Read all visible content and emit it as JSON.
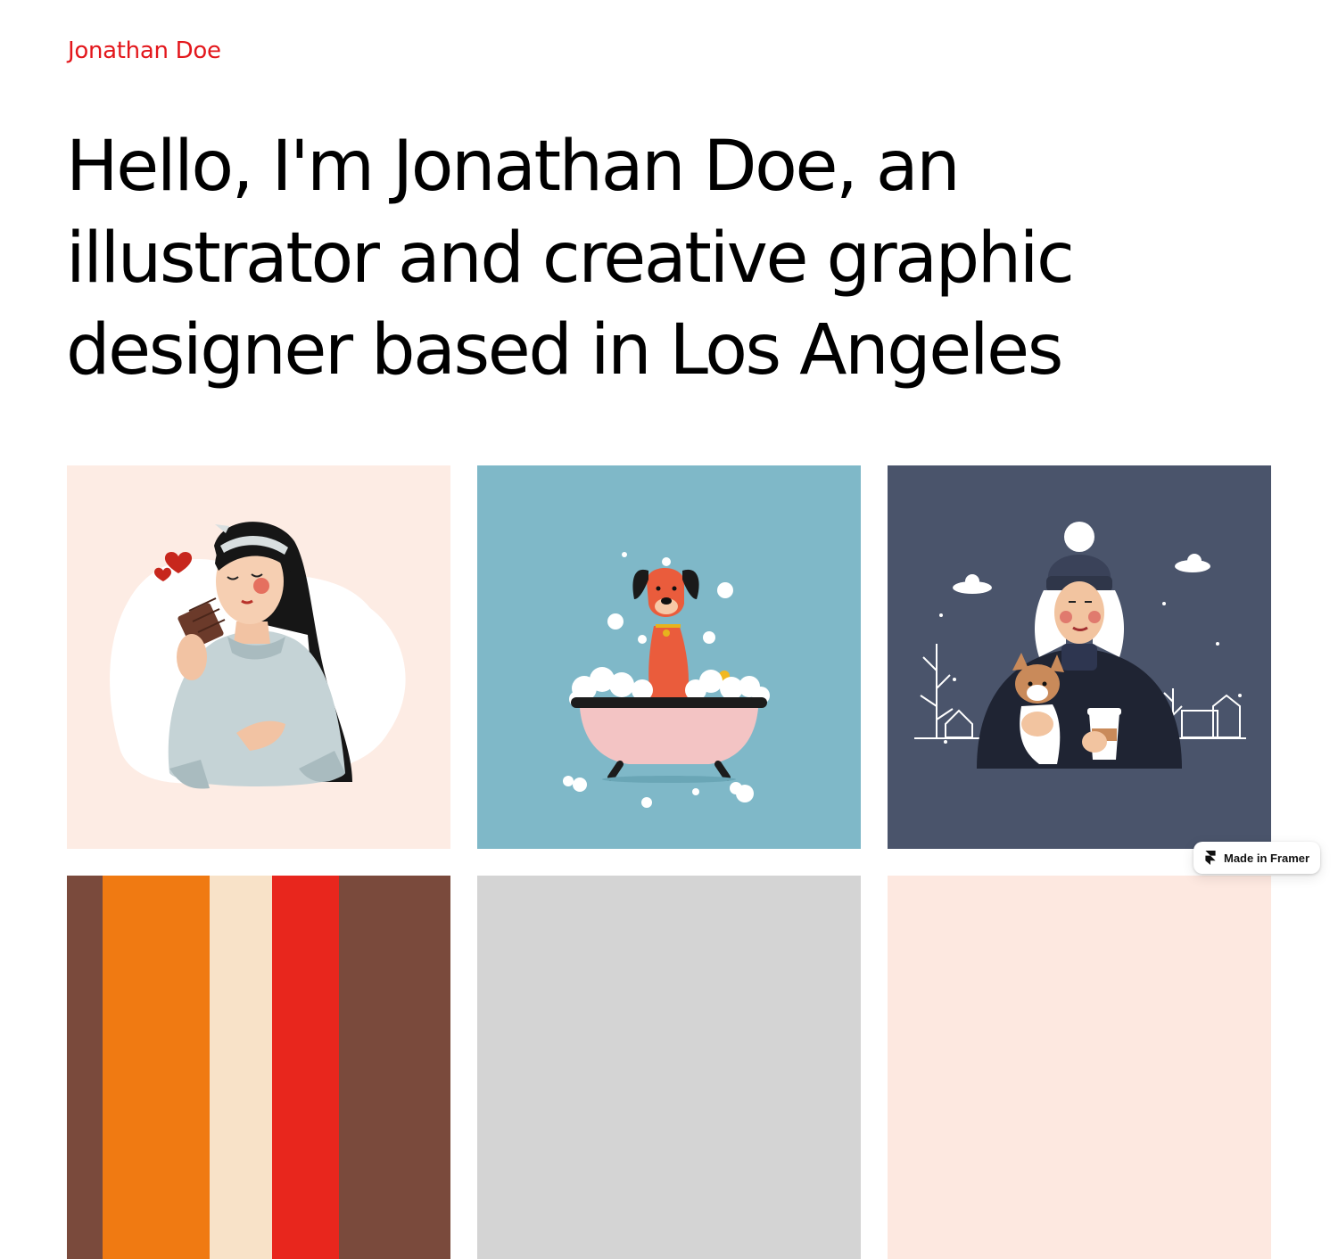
{
  "header": {
    "brand_name": "Jonathan Doe",
    "brand_color": "#e3171c"
  },
  "hero": {
    "lines": [
      "Hello, I'm Jonathan Doe, an",
      "illustrator and creative graphic",
      "designer based in Los Angeles"
    ]
  },
  "gallery": {
    "items": [
      {
        "subject": "woman eating chocolate",
        "background": "#fdece4"
      },
      {
        "subject": "dog in bathtub",
        "background": "#7fb8c8"
      },
      {
        "subject": "woman with dog and coffee in snow",
        "background": "#4a546b"
      },
      {
        "subject": "abstract colorful illustration",
        "background": "#f07a12"
      },
      {
        "subject": "grey illustration",
        "background": "#d4d4d4"
      },
      {
        "subject": "peach illustration",
        "background": "#fde8e0"
      }
    ]
  },
  "framer_badge": {
    "label": "Made in Framer",
    "icon": "framer-logo-icon"
  }
}
